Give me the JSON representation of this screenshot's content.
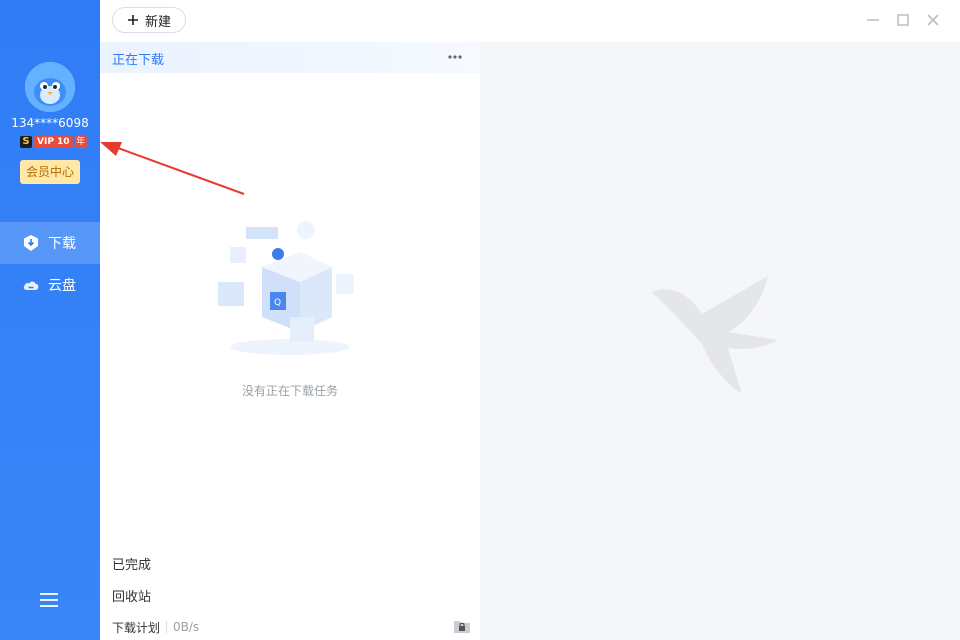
{
  "sidebar": {
    "user": {
      "name": "134****6098"
    },
    "vip": {
      "s": "S",
      "main": "VIP 10",
      "year": "年"
    },
    "member_center": "会员中心",
    "nav": [
      {
        "label": "下载",
        "icon": "download-shield-icon",
        "active": true
      },
      {
        "label": "云盘",
        "icon": "cloud-icon",
        "active": false
      }
    ],
    "menu_icon": "hamburger-menu-icon"
  },
  "toolbar": {
    "new_label": "新建",
    "window_controls": [
      "minimize-icon",
      "maximize-icon",
      "close-icon"
    ]
  },
  "list": {
    "downloading_tab": "正在下载",
    "empty_message": "没有正在下载任务",
    "completed": "已完成",
    "recycle_bin": "回收站",
    "download_plan": "下载计划",
    "speed": "0B/s"
  },
  "colors": {
    "accent": "#2f7cf6",
    "vip_red": "#e94b3c",
    "member_bg": "#ffe8a8"
  }
}
